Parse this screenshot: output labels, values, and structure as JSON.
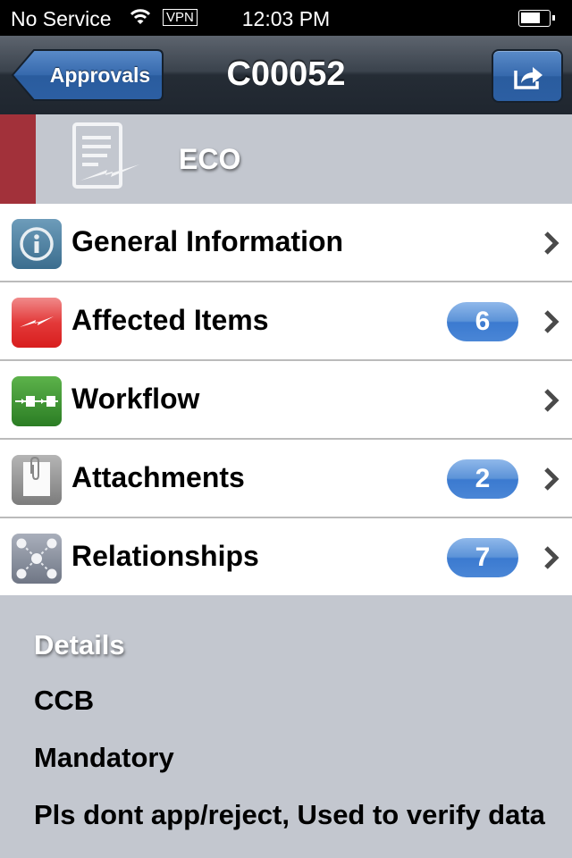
{
  "status_bar": {
    "carrier": "No Service",
    "vpn": "VPN",
    "time": "12:03 PM",
    "battery_level": 0.6
  },
  "nav": {
    "back_label": "Approvals",
    "title": "C00052",
    "action_icon": "share-icon"
  },
  "header": {
    "type_label": "ECO",
    "accent_color": "#a2313a"
  },
  "menu": [
    {
      "label": "General Information",
      "icon": "info-icon",
      "badge": null
    },
    {
      "label": "Affected Items",
      "icon": "lightning-icon",
      "badge": "6"
    },
    {
      "label": "Workflow",
      "icon": "workflow-icon",
      "badge": null
    },
    {
      "label": "Attachments",
      "icon": "paperclip-icon",
      "badge": "2"
    },
    {
      "label": "Relationships",
      "icon": "relationships-icon",
      "badge": "7"
    }
  ],
  "details": {
    "heading": "Details",
    "lines": [
      "CCB",
      "Mandatory",
      "Pls dont app/reject, Used to verify data"
    ]
  }
}
